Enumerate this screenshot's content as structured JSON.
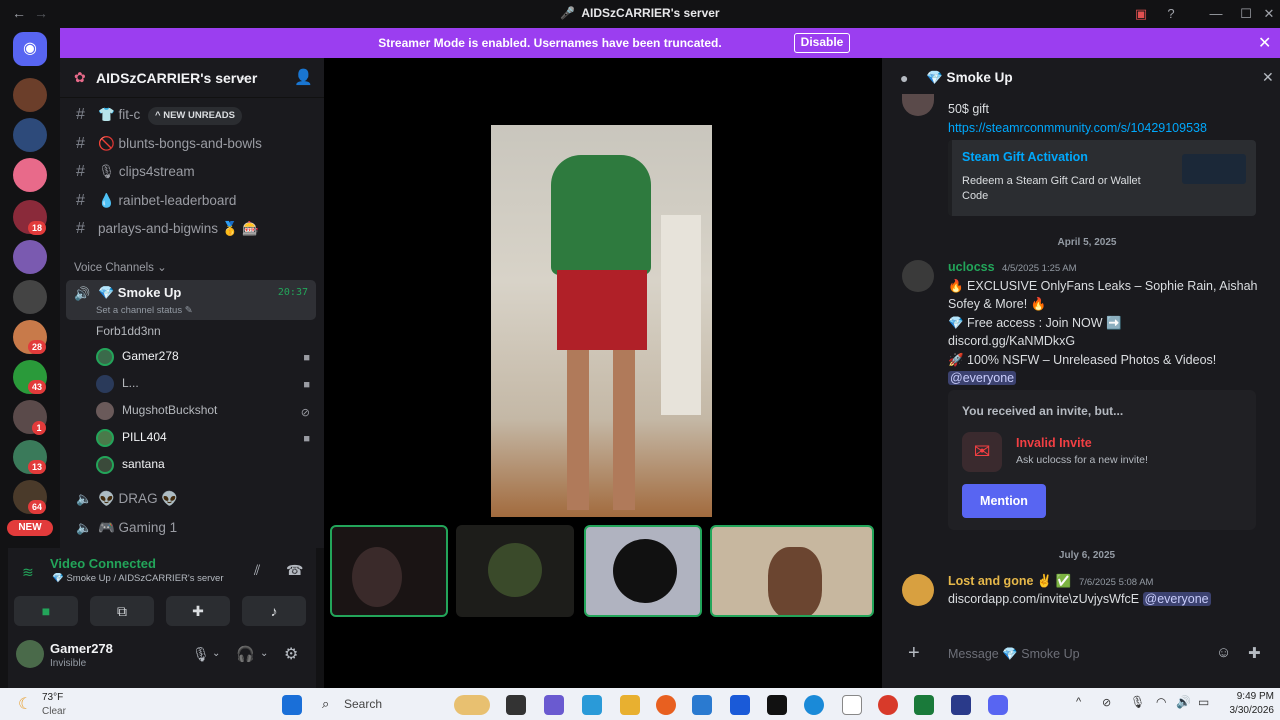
{
  "window": {
    "title": "AIDSzCARRIER's server"
  },
  "banner": {
    "message": "Streamer Mode is enabled. Usernames have been truncated.",
    "button": "Disable"
  },
  "guilds": {
    "badges": [
      "18",
      "28",
      "43",
      "1",
      "13",
      "64"
    ],
    "new_label": "NEW"
  },
  "server": {
    "name": "AIDSzCARRIER's server",
    "unreads_label": "NEW UNREADS"
  },
  "channels": [
    {
      "name": "👕 fit-c"
    },
    {
      "name": "🚫 blunts-bongs-and-bowls"
    },
    {
      "name": "🎙 clips4stream"
    },
    {
      "name": "💧 rainbet-leaderboard"
    },
    {
      "name": "parlays-and-bigwins 🥇 🎰"
    }
  ],
  "voice": {
    "section_label": "Voice Channels",
    "active": {
      "name": "💎 Smoke Up",
      "timer": "20:37",
      "status": "Set a channel status"
    },
    "users": [
      "Forb1dd3nn",
      "Gamer278",
      "L...",
      "MugshotBuckshot",
      "PILL404",
      "santana"
    ],
    "other_channels": [
      "👽 DRAG 👽",
      "🎮 Gaming 1"
    ]
  },
  "connection": {
    "title": "Video Connected",
    "subtitle": "💎 Smoke Up / AIDSzCARRIER's server"
  },
  "me": {
    "name": "Gamer278",
    "status": "Invisible"
  },
  "chat": {
    "title": "💎 Smoke Up",
    "msg1_text": "50$ gift",
    "msg1_link": "https://steamrconmmunity.com/s/10429109538",
    "embed_title": "Steam Gift Activation",
    "embed_desc_1": "Redeem a Steam Gift Card or Wallet",
    "embed_desc_2": "Code",
    "date1": "April 5, 2025",
    "msg2_author": "uclocss",
    "msg2_time": "4/5/2025 1:25 AM",
    "msg2_l1": "🔥 EXCLUSIVE OnlyFans Leaks – Sophie Rain, Aishah",
    "msg2_l2": "Sofey & More! 🔥",
    "msg2_l3": "💎 Free access : Join NOW ➡️",
    "msg2_l4": "discord.gg/KaNMDkxG",
    "msg2_l5": "🚀 100% NSFW – Unreleased Photos & Videos!",
    "msg2_l6": "@everyone",
    "invite_header": "You received an invite, but...",
    "invite_title": "Invalid Invite",
    "invite_sub": "Ask uclocss for a new invite!",
    "invite_button": "Mention",
    "date2": "July 6, 2025",
    "msg3_author": "Lost and gone ✌️ ✅",
    "msg3_time": "7/6/2025 5:08 AM",
    "msg3_text": "discordapp.com/invite\\zUvjysWfcE",
    "msg3_mention": "@everyone",
    "input_placeholder": "Message 💎 Smoke Up"
  },
  "taskbar": {
    "weather_temp": "73°F",
    "weather_desc": "Clear",
    "search": "Search",
    "time": "9:49 PM",
    "date": "3/30/2026"
  },
  "colors": {
    "accent": "#5865f2",
    "banner": "#9b3ef0",
    "voice_green": "#23a55a"
  }
}
